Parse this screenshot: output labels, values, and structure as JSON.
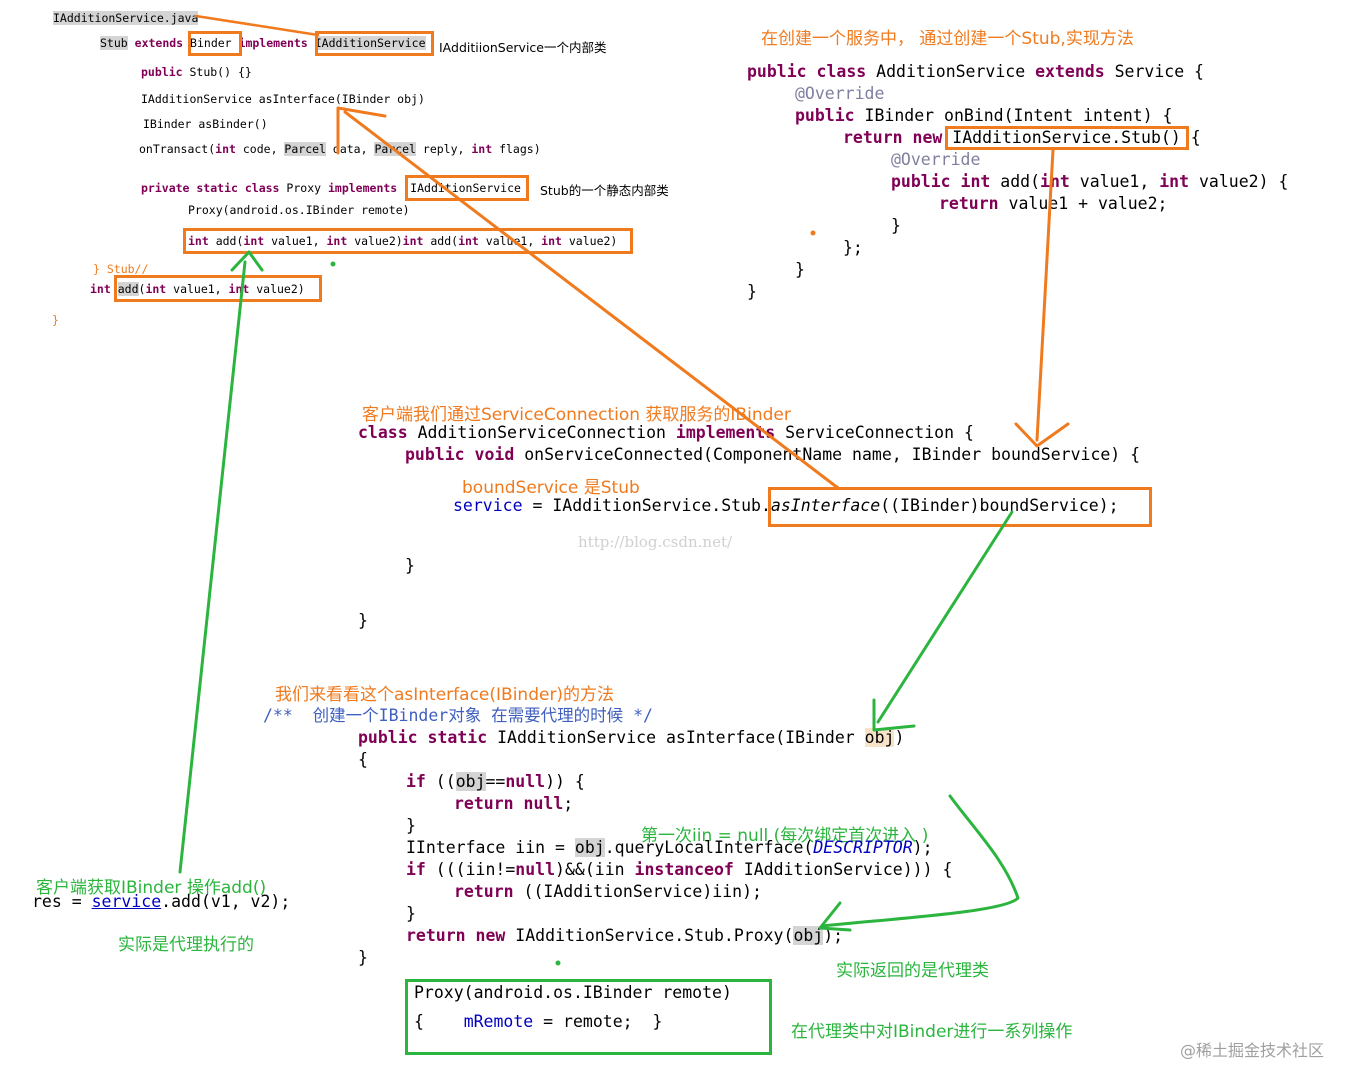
{
  "outline": {
    "file": "IAdditionService.java",
    "stub_name": "Stub",
    "extends_kw": "extends",
    "binder": "Binder",
    "implements_kw": "implements",
    "iface": "IAdditionService",
    "stub_note": "IAdditiionService一个内部类",
    "ctor_kw": "public",
    "ctor_rest": "Stub() {}",
    "as_interface": "IAdditionService asInterface(IBinder obj)",
    "as_binder": "IBinder asBinder()",
    "ontransact_a": "onTransact(",
    "ontransact_int1": "int",
    "ontransact_b": " code, ",
    "ontransact_parcel1": "Parcel",
    "ontransact_c": " data, ",
    "ontransact_parcel2": "Parcel",
    "ontransact_d": " reply, ",
    "ontransact_int2": "int",
    "ontransact_e": " flags)",
    "proxy_kw": "private static class",
    "proxy_name": "Proxy",
    "proxy_impl": "implements",
    "proxy_iface": "IAdditionService",
    "proxy_note": "Stub的一个静态内部类",
    "proxy_ctor": "Proxy(android.os.IBinder remote)",
    "proxy_add_kw1": "int",
    "proxy_add_a": " add(",
    "proxy_add_kw2": "int",
    "proxy_add_b": " value1, ",
    "proxy_add_kw3": "int",
    "proxy_add_c": " value2)",
    "proxy_add_kw4": "int",
    "proxy_add_d": " add(",
    "proxy_add_kw5": "int",
    "proxy_add_e": " value1, ",
    "proxy_add_kw6": "int",
    "proxy_add_f": " value2)",
    "stub_end": "} Stub//",
    "iface_add_kw": "int",
    "iface_add_name": "add",
    "iface_add_a": "(",
    "iface_add_kw2": "int",
    "iface_add_b": " value1, ",
    "iface_add_kw3": "int",
    "iface_add_c": " value2)",
    "close_brace": "}"
  },
  "service": {
    "note": "在创建一个服务中， 通过创建一个Stub,实现方法",
    "l1_kw": "public class",
    "l1_name": " AdditionService ",
    "l1_kw2": "extends",
    "l1_rest": " Service {",
    "l2": "@Override",
    "l3_kw": "public",
    "l3_rest": " IBinder onBind(Intent intent) {",
    "l4_kw": "return new",
    "l4_rest": " IAdditionService.Stub()",
    "l4_end": " {",
    "l5": "@Override",
    "l6_kw": "public int",
    "l6_a": " add(",
    "l6_kw2": "int",
    "l6_b": " value1, ",
    "l6_kw3": "int",
    "l6_c": " value2) {",
    "l7_kw": "return",
    "l7_rest": " value1 + value2;",
    "l8": "}",
    "l9": "};",
    "l10": "}",
    "l11": "}"
  },
  "connection": {
    "note": "客户端我们通过ServiceConnection 获取服务的IBinder",
    "l1_kw": "class",
    "l1_a": " AdditionServiceConnection ",
    "l1_kw2": "implements",
    "l1_b": " ServiceConnection {",
    "l2_kw": "public void",
    "l2_rest": " onServiceConnected(ComponentName name, IBinder boundService) {",
    "bound_note": "boundService 是Stub",
    "l3_field": "service",
    "l3_a": " = IAdditionService.Stub.",
    "l3_method": "asInterface",
    "l3_b": "((IBinder)boundService);",
    "l4": "}",
    "l5": "}",
    "watermark": "http://blog.csdn.net/"
  },
  "asinterface": {
    "note": "我们来看看这个asInterface(IBinder)的方法",
    "comment": "/**  创建一个IBinder对象 在需要代理的时候 */",
    "l1_kw": "public static",
    "l1_a": " IAdditionService asInterface(IBinder ",
    "l1_obj": "obj",
    "l1_b": ")",
    "l2": "{",
    "l3_kw": "if",
    "l3_a": " ((",
    "l3_obj": "obj",
    "l3_b": "==",
    "l3_kw2": "null",
    "l3_c": ")) {",
    "l4_kw": "return null",
    "l4_rest": ";",
    "l5": "}",
    "l6_a": "IInterface iin = ",
    "l6_obj": "obj",
    "l6_b": ".queryLocalInterface(",
    "l6_const": "DESCRIPTOR",
    "l6_c": ");",
    "l7_kw": "if",
    "l7_a": " (((iin!=",
    "l7_kw2": "null",
    "l7_b": ")&&(iin ",
    "l7_kw3": "instanceof",
    "l7_c": " IAdditionService))) {",
    "l8_kw": "return",
    "l8_rest": " ((IAdditionService)iin);",
    "l9": "}",
    "l10_kw": "return new",
    "l10_a": " IAdditionService.Stub.Proxy(",
    "l10_obj": "obj",
    "l10_b": ");",
    "l11": "}",
    "first_note": "第一次iin = null (每次绑定首次进入 )",
    "return_note": "实际返回的是代理类",
    "proxy_l1": "Proxy(android.os.IBinder remote)",
    "proxy_l2a": "{",
    "proxy_field": "mRemote",
    "proxy_l2b": " = remote;",
    "proxy_l2c": "}",
    "proxy_note": "在代理类中对IBinder进行一系列操作"
  },
  "client": {
    "note": "客户端获取IBinder 操作add()",
    "code_a": "res = ",
    "code_field": "service",
    "code_b": ".add(v1, v2);",
    "note2": "实际是代理执行的"
  },
  "footer": {
    "watermark": "@稀土掘金技术社区"
  },
  "colors": {
    "orange": "#f07a1e",
    "green": "#2bb53e",
    "keyword": "#7f0055",
    "field": "#0000c0",
    "comment": "#3f5fbf"
  }
}
